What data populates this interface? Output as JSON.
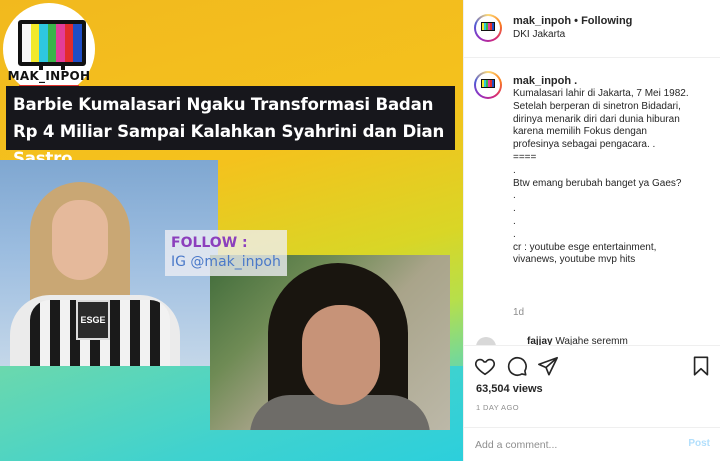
{
  "media": {
    "logo_text": "MAK_INPOH",
    "logo_bar_colors": [
      "#f6f6f6",
      "#f2e92a",
      "#2ec7df",
      "#3ab44a",
      "#e33d98",
      "#e22c2c",
      "#1f4ec6"
    ],
    "headline": "Barbie Kumalasari Ngaku Transformasi Badan Rp 4 Miliar Sampai Kalahkan Syahrini dan Dian Sastro",
    "follow_label": "FOLLOW :",
    "follow_handle": "IG @mak_inpoh",
    "mic_label": "ESGE"
  },
  "header": {
    "username": "mak_inpoh",
    "separator": "•",
    "follow_status": "Following",
    "location": "DKI Jakarta"
  },
  "caption": {
    "username": "mak_inpoh",
    "suffix": " .",
    "lines": [
      "Kumalasari lahir di Jakarta, 7 Mei 1982.",
      "Setelah berperan di sinetron Bidadari,",
      "dirinya menarik diri dari dunia hiburan",
      "karena memilih Fokus dengan",
      "profesinya sebagai pengacara. .",
      "====",
      ".",
      "Btw emang berubah banget ya Gaes?",
      ".",
      ".",
      ".",
      ".",
      "cr : youtube esge entertainment,",
      "vivanews, youtube mvp hits"
    ],
    "time": "1d"
  },
  "reply": {
    "username": "fajjay",
    "text": "Wajahe seremm"
  },
  "actions": {
    "likes": "63,504 views",
    "post_age": "1 DAY AGO",
    "comment_placeholder": "Add a comment...",
    "post_label": "Post"
  },
  "icons": [
    "heart-icon",
    "comment-icon",
    "share-icon",
    "bookmark-icon"
  ]
}
